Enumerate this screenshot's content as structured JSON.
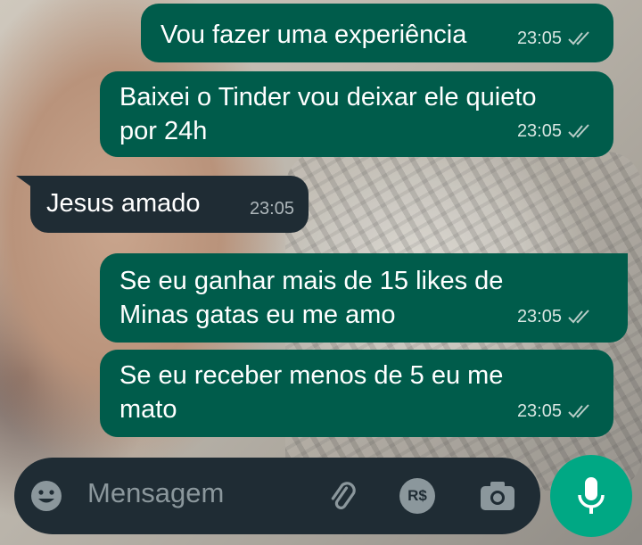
{
  "messages": [
    {
      "direction": "outgoing",
      "text": "Vou fazer uma experiência",
      "time": "23:05",
      "status": "read"
    },
    {
      "direction": "outgoing",
      "text": "Baixei o Tinder vou deixar ele quieto\npor 24h",
      "time": "23:05",
      "status": "read"
    },
    {
      "direction": "incoming",
      "text": "Jesus amado",
      "time": "23:05"
    },
    {
      "direction": "outgoing",
      "text": "Se eu ganhar mais de 15 likes de\nMinas gatas eu me amo",
      "time": "23:05",
      "status": "read"
    },
    {
      "direction": "outgoing",
      "text": "Se eu receber menos de 5 eu me\nmato",
      "time": "23:05",
      "status": "read"
    }
  ],
  "composer": {
    "placeholder": "Mensagem",
    "icons": [
      "emoji-icon",
      "attach-icon",
      "payment-icon",
      "camera-icon",
      "mic-icon"
    ],
    "payment_label": "R$"
  },
  "colors": {
    "outgoing_bubble": "#005c4b",
    "incoming_bubble": "#1f2c34",
    "accent": "#00a884"
  }
}
